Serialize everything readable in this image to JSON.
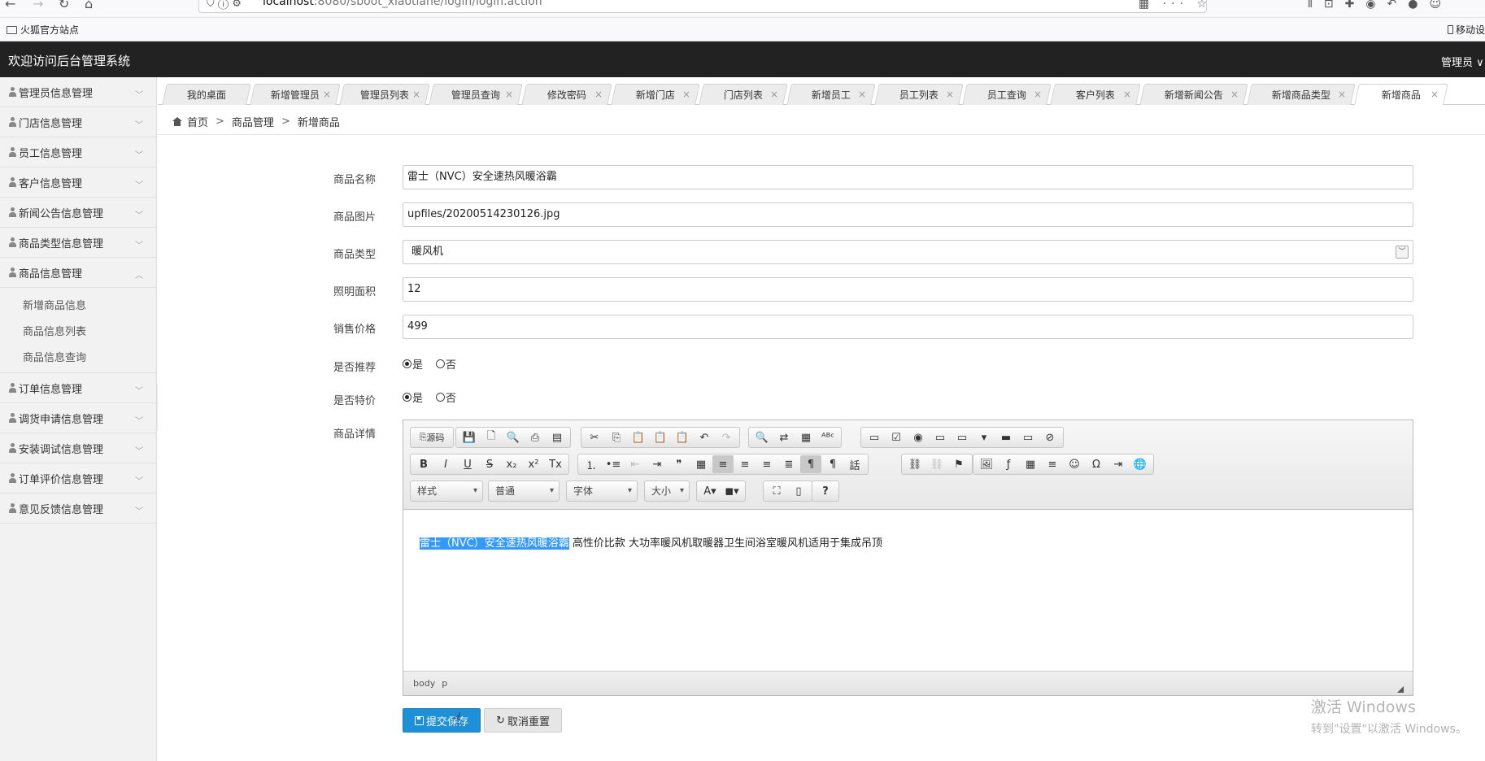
{
  "browser": {
    "url_host": "localhost",
    "url_path": ":8080/sboot_xiaotiane/login/login.action",
    "bookmark": "火狐官方站点",
    "mobile_bookmark": "移动设"
  },
  "header": {
    "title": "欢迎访问后台管理系统",
    "user": "管理员 ∨"
  },
  "sidebar": {
    "items": [
      {
        "label": "管理员信息管理"
      },
      {
        "label": "门店信息管理"
      },
      {
        "label": "员工信息管理"
      },
      {
        "label": "客户信息管理"
      },
      {
        "label": "新闻公告信息管理"
      },
      {
        "label": "商品类型信息管理"
      },
      {
        "label": "商品信息管理"
      },
      {
        "label": "订单信息管理"
      },
      {
        "label": "调货申请信息管理"
      },
      {
        "label": "安装调试信息管理"
      },
      {
        "label": "订单评价信息管理"
      },
      {
        "label": "意见反馈信息管理"
      }
    ],
    "submenu": [
      "新增商品信息",
      "商品信息列表",
      "商品信息查询"
    ]
  },
  "tabs": [
    "我的桌面",
    "新增管理员",
    "管理员列表",
    "管理员查询",
    "修改密码",
    "新增门店",
    "门店列表",
    "新增员工",
    "员工列表",
    "员工查询",
    "客户列表",
    "新增新闻公告",
    "新增商品类型",
    "新增商品"
  ],
  "breadcrumb": {
    "home": "首页",
    "level1": "商品管理",
    "level2": "新增商品",
    "sep": ">"
  },
  "form": {
    "name_label": "商品名称",
    "name_value": "雷士（NVC）安全速热风暖浴霸",
    "image_label": "商品图片",
    "image_value": "upfiles/20200514230126.jpg",
    "type_label": "商品类型",
    "type_value": "暖风机",
    "area_label": "照明面积",
    "area_value": "12",
    "price_label": "销售价格",
    "price_value": "499",
    "recommend_label": "是否推荐",
    "special_label": "是否特价",
    "yes": "是",
    "no": "否",
    "detail_label": "商品详情"
  },
  "editor": {
    "source_label": "源码",
    "combo_style": "样式",
    "combo_format": "普通",
    "combo_font": "字体",
    "combo_size": "大小",
    "help": "?",
    "content_selected": "雷士（NVC）安全速热风暖浴霸",
    "content_rest": " 高性价比款 大功率暖风机取暖器卫生间浴室暖风机适用于集成吊顶",
    "status_body": "body",
    "status_p": "p"
  },
  "buttons": {
    "submit": "提交保存",
    "reset": "取消重置"
  },
  "watermark": {
    "line1": "激活 Windows",
    "line2": "转到\"设置\"以激活 Windows。"
  }
}
